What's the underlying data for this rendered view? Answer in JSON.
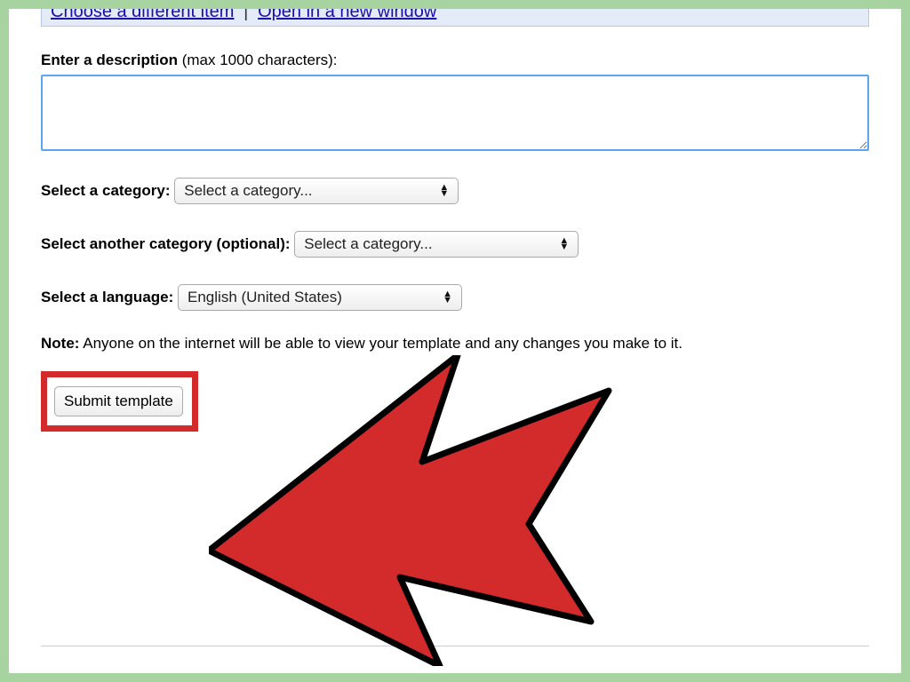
{
  "top_links": {
    "choose": "Choose a different item",
    "separator": "|",
    "open": "Open in a new window"
  },
  "description": {
    "label": "Enter a description",
    "hint": " (max 1000 characters):",
    "value": ""
  },
  "category1": {
    "label": "Select a category:",
    "selected": "Select a category..."
  },
  "category2": {
    "label": "Select another category (optional):",
    "selected": "Select a category..."
  },
  "language": {
    "label": "Select a language:",
    "selected": "English (United States)"
  },
  "note": {
    "label": "Note:",
    "text": " Anyone on the internet will be able to view your template and any changes you make to it."
  },
  "submit": {
    "label": "Submit template"
  }
}
